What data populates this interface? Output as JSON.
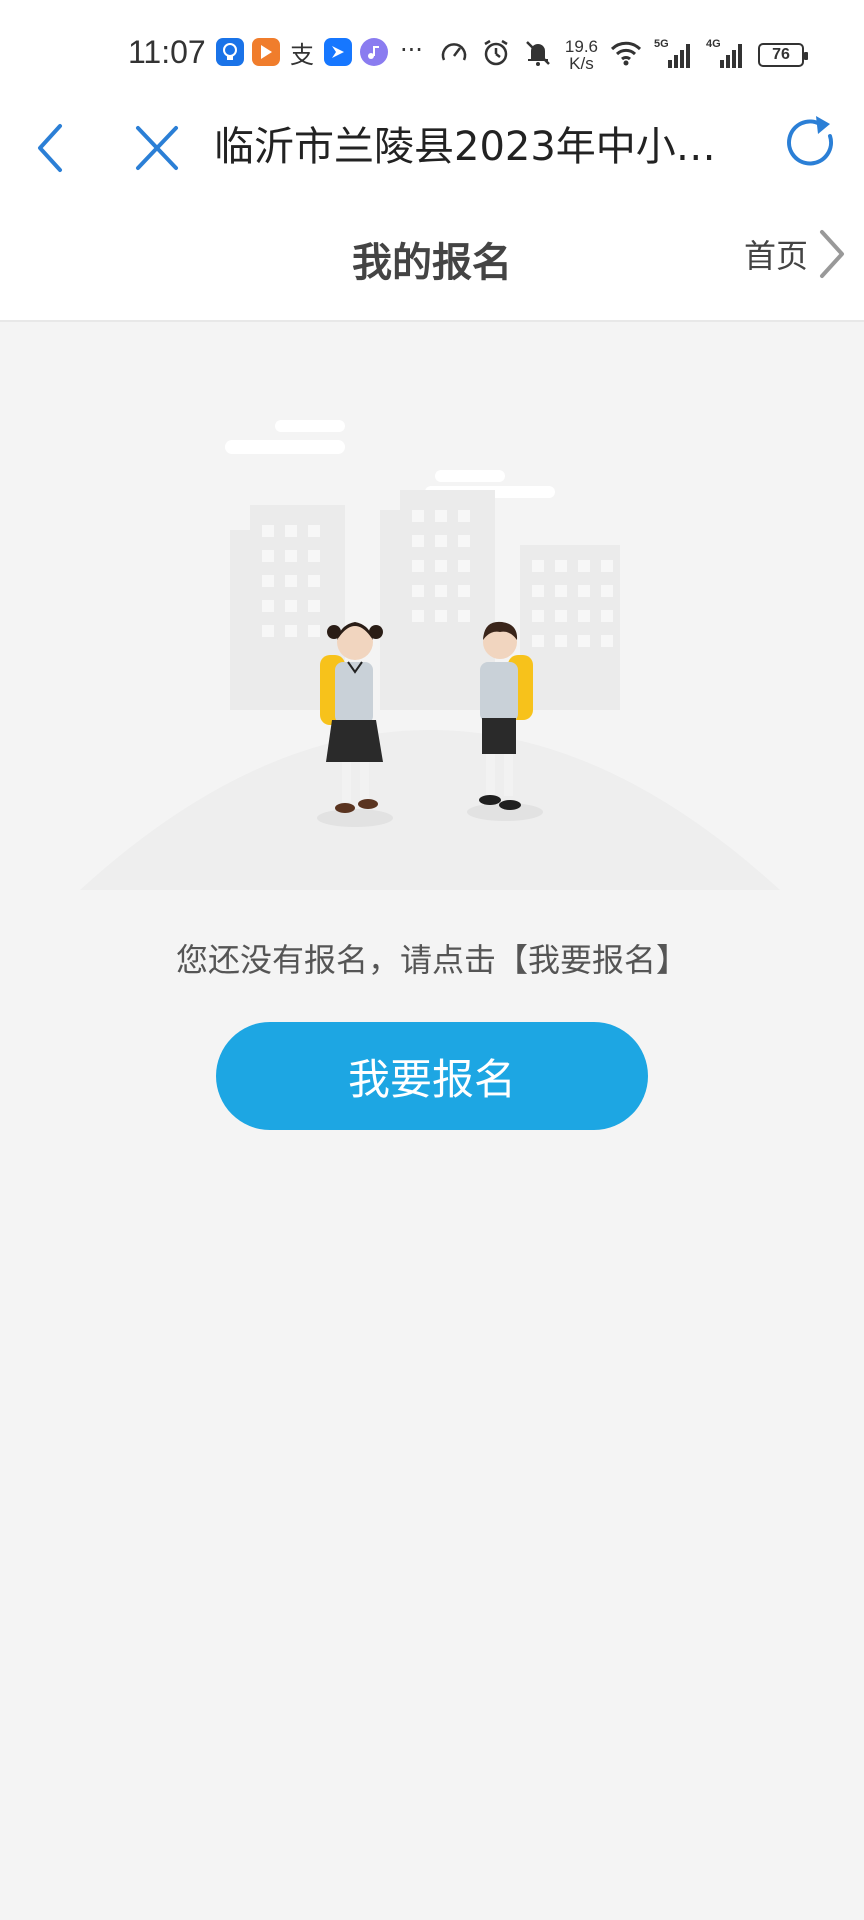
{
  "status_bar": {
    "time": "11:07",
    "more": "···",
    "net_speed_value": "19.6",
    "net_speed_unit": "K/s",
    "signal_1_label": "5G",
    "signal_2_label": "4G",
    "battery": "76",
    "app_icons": [
      "lightbulb-app",
      "video-app",
      "alipay-app",
      "bird-app",
      "music-app"
    ],
    "alipay_glyph": "支"
  },
  "nav": {
    "title": "临沂市兰陵县2023年中小…",
    "accent_color": "#2b7fd6"
  },
  "header": {
    "title": "我的报名",
    "home_label": "首页"
  },
  "main": {
    "empty_message": "您还没有报名，请点击【我要报名】",
    "cta_label": "我要报名",
    "cta_color": "#1da6e3"
  }
}
